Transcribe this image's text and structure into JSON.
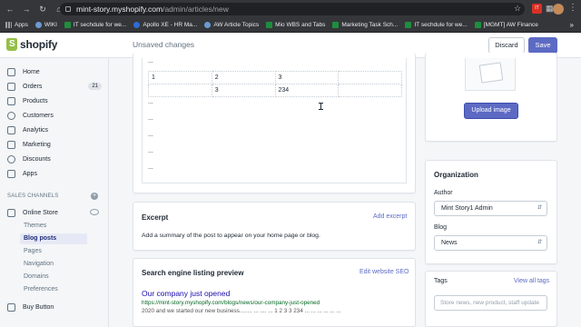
{
  "browser": {
    "url_host": "mint-story.myshopify.com",
    "url_path": "/admin/articles/new",
    "ext_badge": "IT",
    "bookmarks": [
      {
        "label": "Apps",
        "icon": "apps-grid-icon"
      },
      {
        "label": "WIKI",
        "icon": "globe-icon"
      },
      {
        "label": "IT sechdule for we...",
        "icon": "sheets-icon"
      },
      {
        "label": "Apollo XE - HR Ma...",
        "icon": "globe-icon"
      },
      {
        "label": "AW Article Topics",
        "icon": "globe-icon"
      },
      {
        "label": "Mio WBS and Tabs",
        "icon": "sheets-icon"
      },
      {
        "label": "Marketing Task Sch...",
        "icon": "sheets-icon"
      },
      {
        "label": "IT sechdule for we...",
        "icon": "sheets-icon"
      },
      {
        "label": "[MGMT] AW Finance",
        "icon": "sheets-icon"
      }
    ]
  },
  "topbar": {
    "logo_text": "shopify",
    "status": "Unsaved changes",
    "discard_label": "Discard",
    "save_label": "Save"
  },
  "sidebar": {
    "items": [
      {
        "label": "Home",
        "icon": "home-icon"
      },
      {
        "label": "Orders",
        "icon": "orders-icon",
        "badge": "21"
      },
      {
        "label": "Products",
        "icon": "tag-icon"
      },
      {
        "label": "Customers",
        "icon": "customers-icon"
      },
      {
        "label": "Analytics",
        "icon": "analytics-icon"
      },
      {
        "label": "Marketing",
        "icon": "marketing-icon"
      },
      {
        "label": "Discounts",
        "icon": "discount-icon"
      },
      {
        "label": "Apps",
        "icon": "apps-icon"
      }
    ],
    "sales_channels_header": "SALES CHANNELS",
    "online_store": "Online Store",
    "sub_items": [
      "Themes",
      "Blog posts",
      "Pages",
      "Navigation",
      "Domains",
      "Preferences"
    ],
    "buy_button": "Buy Button"
  },
  "editor": {
    "dots": "...",
    "table": [
      [
        "1",
        "2",
        "3",
        ""
      ],
      [
        "",
        "3",
        "234",
        ""
      ]
    ]
  },
  "excerpt": {
    "title": "Excerpt",
    "link": "Add excerpt",
    "text": "Add a summary of the post to appear on your home page or blog."
  },
  "seo": {
    "title": "Search engine listing preview",
    "link": "Edit website SEO",
    "preview_title": "Our company just opened",
    "preview_url": "https://mint-story.myshopify.com/blogs/news/our-company-just-opened",
    "preview_desc": "2020 and we started our new business........ ... .... ... 1 2 3 3 234 ... ... ... ... ... ..."
  },
  "image": {
    "upload_label": "Upload image"
  },
  "organization": {
    "title": "Organization",
    "author_label": "Author",
    "author_value": "Mint Story1 Admin",
    "blog_label": "Blog",
    "blog_value": "News",
    "tags_label": "Tags",
    "tags_link": "View all tags",
    "tags_placeholder": "Store news, new product, staff update"
  }
}
